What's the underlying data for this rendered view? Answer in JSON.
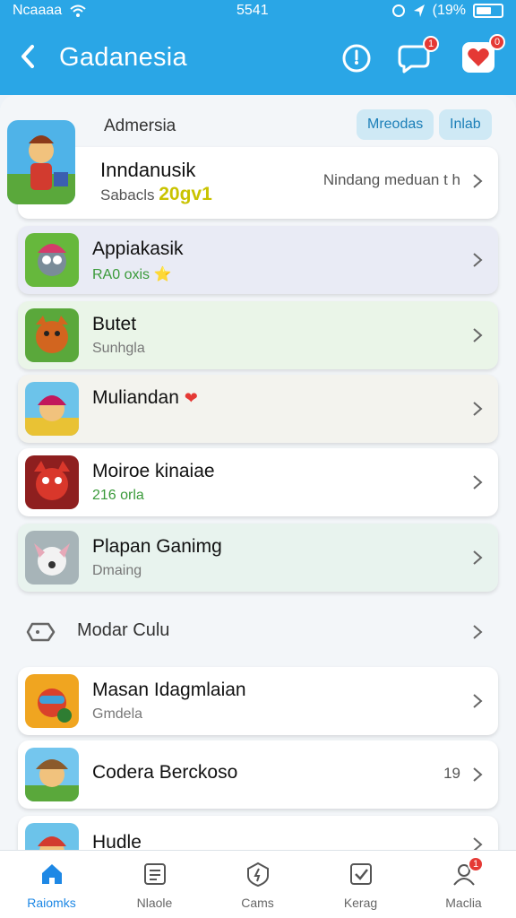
{
  "status": {
    "carrier": "Ncaaaa",
    "time": "5541",
    "battery": "(19%"
  },
  "appbar": {
    "title": "Gadanesia"
  },
  "header": {
    "label": "Admersia",
    "chips": [
      "Mreodas",
      "Inlab"
    ]
  },
  "featured": {
    "name": "Inndanusik",
    "sub_prefix": "Sabacls",
    "sub_value": "20gv1",
    "meta": "Nindang meduan t h"
  },
  "rows": [
    {
      "name": "Appiakasik",
      "sub": "RA0 oxis ⭐",
      "sub_color": "#3a9a3a",
      "bg": "#e9ebf5"
    },
    {
      "name": "Butet",
      "sub": "Sunhgla",
      "sub_color": "#777777",
      "bg": "#eaf5e8"
    },
    {
      "name": "Muliandan",
      "sub": "",
      "sub_color": "#777777",
      "bg": "#f3f3ee"
    },
    {
      "name": "Moiroe kinaiae",
      "sub": "216 orla",
      "sub_color": "#3a9a3a",
      "bg": "#ffffff"
    },
    {
      "name": "Plapan Ganimg",
      "sub": "Dmaing",
      "sub_color": "#777777",
      "bg": "#e8f3ee"
    }
  ],
  "plain_row": {
    "label": "Modar Culu"
  },
  "rows2": [
    {
      "name": "Masan Idagmlaian",
      "sub": "Gmdela",
      "sub_color": "#777777"
    },
    {
      "name": "Codera Berckoso",
      "sub": "",
      "meta": "19"
    },
    {
      "name": "Hudle",
      "sub": ""
    }
  ],
  "tabs": [
    {
      "label": "Raiomks",
      "icon": "home-icon"
    },
    {
      "label": "Nlaole",
      "icon": "news-icon"
    },
    {
      "label": "Cams",
      "icon": "shield-icon"
    },
    {
      "label": "Kerag",
      "icon": "check-box-icon"
    },
    {
      "label": "Maclia",
      "icon": "profile-icon",
      "badge": "1"
    }
  ],
  "badges": {
    "notifications": "1",
    "messages": "0"
  },
  "colors": {
    "primary": "#2aa6e6",
    "badge": "#e53935",
    "active_tab": "#1e88e5"
  }
}
